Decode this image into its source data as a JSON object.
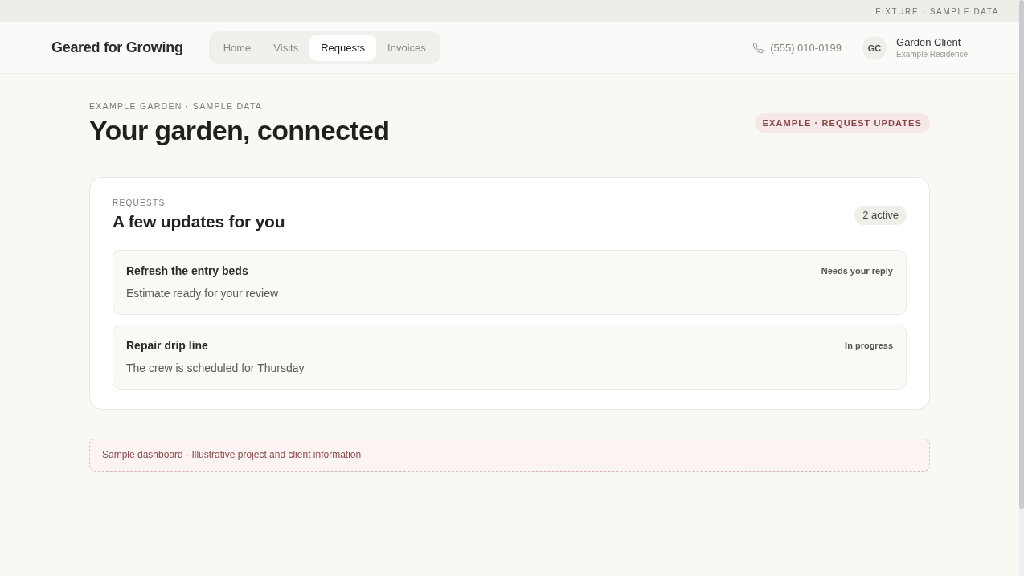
{
  "top_strip": {
    "label": "FIXTURE · SAMPLE DATA"
  },
  "header": {
    "brand": "Geared for Growing",
    "tabs": [
      {
        "label": "Home",
        "selected": false
      },
      {
        "label": "Visits",
        "selected": false
      },
      {
        "label": "Requests",
        "selected": true
      },
      {
        "label": "Invoices",
        "selected": false
      }
    ],
    "phone": "(555) 010-0199",
    "account": {
      "initials": "GC",
      "name": "Garden Client",
      "subtitle": "Example Residence"
    }
  },
  "page": {
    "eyebrow": "EXAMPLE GARDEN · SAMPLE DATA",
    "title": "Your garden, connected",
    "badge": "EXAMPLE · REQUEST UPDATES"
  },
  "requests_card": {
    "eyebrow": "REQUESTS",
    "title": "A few updates for you",
    "count": "2 active",
    "items": [
      {
        "title": "Refresh the entry beds",
        "detail": "Estimate ready for your review",
        "status": "Needs your reply"
      },
      {
        "title": "Repair drip line",
        "detail": "The crew is scheduled for Thursday",
        "status": "In progress"
      }
    ]
  },
  "notice": "Sample dashboard · Illustrative project and client information"
}
